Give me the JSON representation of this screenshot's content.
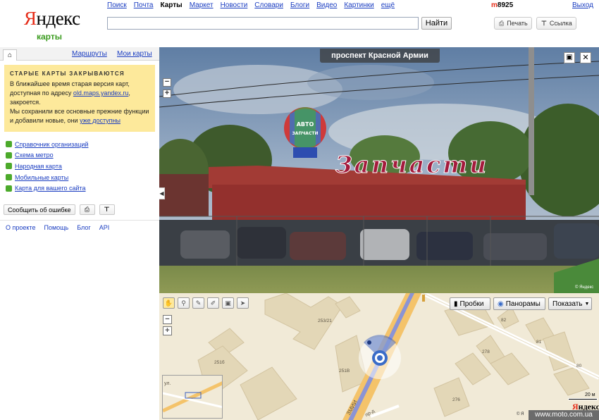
{
  "header": {
    "logo_first": "Я",
    "logo_rest": "ндекс",
    "logo_sub": "карты",
    "services": [
      {
        "label": "Поиск",
        "current": false
      },
      {
        "label": "Почта",
        "current": false
      },
      {
        "label": "Карты",
        "current": true
      },
      {
        "label": "Маркет",
        "current": false
      },
      {
        "label": "Новости",
        "current": false
      },
      {
        "label": "Словари",
        "current": false
      },
      {
        "label": "Блоги",
        "current": false
      },
      {
        "label": "Видео",
        "current": false
      },
      {
        "label": "Картинки",
        "current": false
      }
    ],
    "more_label": "ещё",
    "search_value": "",
    "search_button": "Найти",
    "user_first": "m",
    "user_rest": "8925",
    "logout": "Выход",
    "print_label": "Печать",
    "link_label": "Ссылка"
  },
  "sidebar": {
    "tab_routes": "Маршруты",
    "tab_mymaps": "Мои карты",
    "notice": {
      "title": "СТАРЫЕ КАРТЫ ЗАКРЫВАЮТСЯ",
      "line1": "В ближайшее время старая версия карт,",
      "line2_prefix": "доступная по адресу ",
      "line2_link": "old.maps.yandex.ru",
      "line2_suffix": ",",
      "line3": "закроется.",
      "line4": "Мы сохранили все основные прежние функции",
      "line5_prefix": "и добавили новые, они ",
      "line5_link": "уже доступны"
    },
    "links": [
      "Справочник организаций",
      "Схема метро",
      "Народная карта",
      "Мобильные карты",
      "Карта для вашего сайта"
    ],
    "report_button": "Сообщить об ошибке",
    "footer": [
      "О проекте",
      "Помощь",
      "Блог",
      "API"
    ]
  },
  "panorama": {
    "title": "проспект Красной Армии",
    "sign_text": "Запчасти",
    "balloon_text_top": "АВТО",
    "balloon_text_bottom": "ЗАПЧАСТИ",
    "copyright": "© Яндекс"
  },
  "map": {
    "traffic_label": "Пробки",
    "panoramas_label": "Панорамы",
    "show_label": "Показать",
    "house_numbers": [
      "253/21",
      "251б",
      "251В",
      "82",
      "278",
      "81",
      "80",
      "276"
    ],
    "street_label_1": "ул.",
    "street_label_2": "ЗМИИ",
    "street_label_3": "пр-д",
    "scale_label": "20 м",
    "logo_first": "Я",
    "logo_rest": "ндекс",
    "copyright": "© Я"
  },
  "watermark": "www.moto.com.ua",
  "colors": {
    "link": "#1a3dc1",
    "logo_red": "#e52b17",
    "logo_green": "#3a9b1e",
    "notice_bg": "#fde99b",
    "road_blue": "#7f8fe0",
    "road_orange": "#f4c36a"
  }
}
